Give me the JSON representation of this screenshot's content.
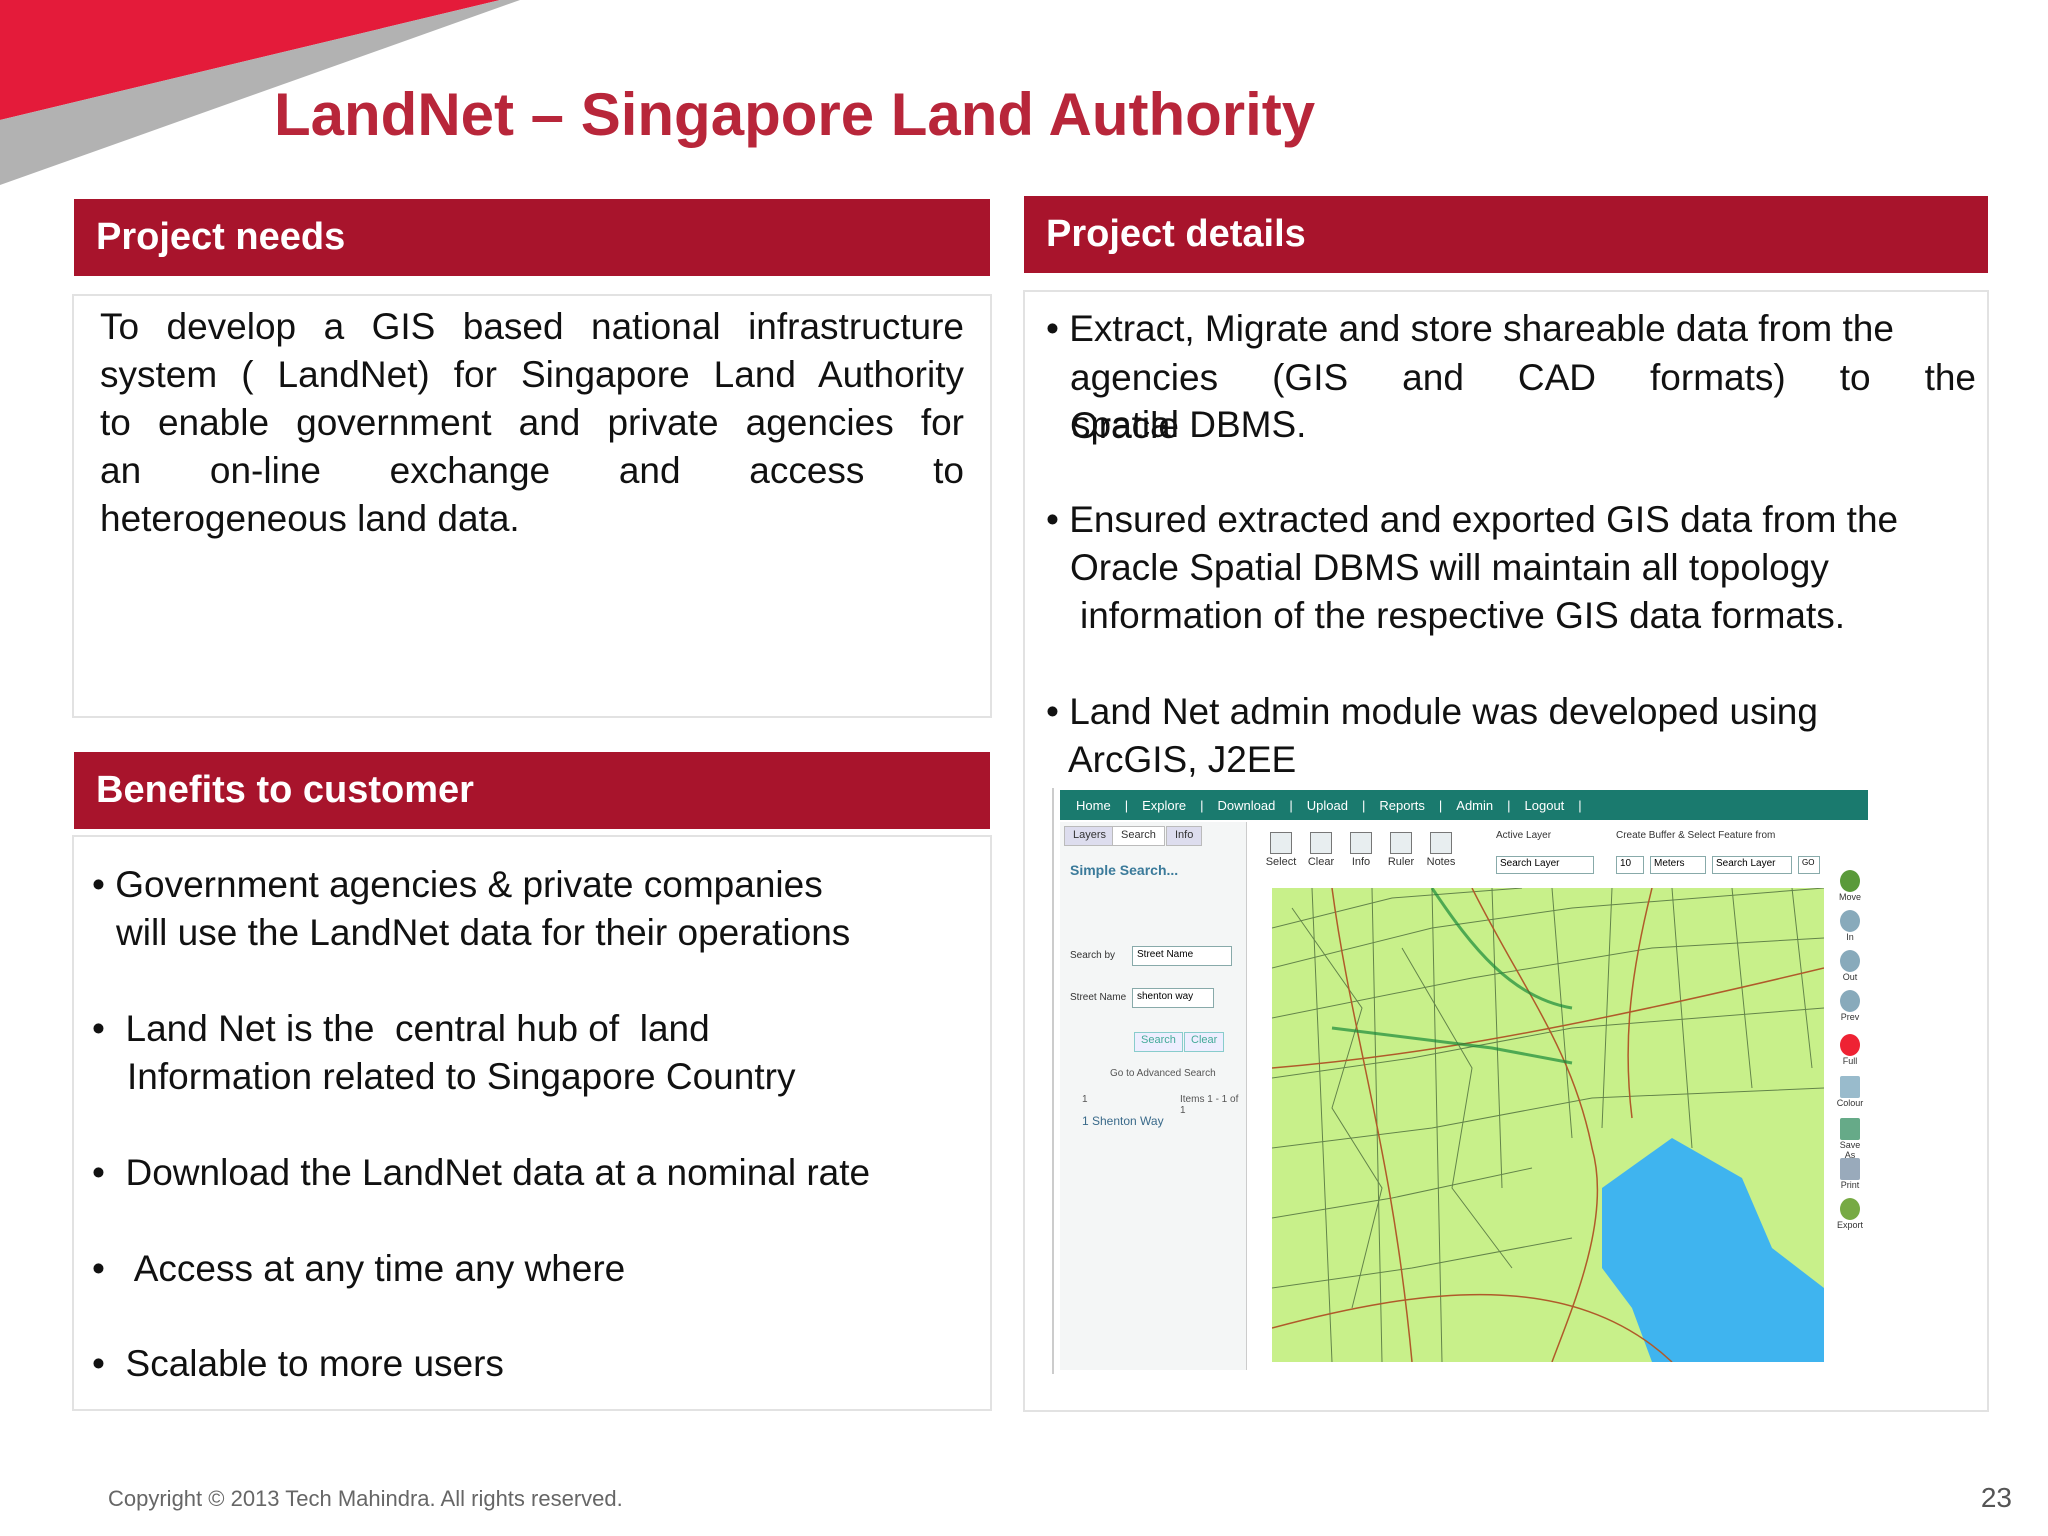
{
  "slide": {
    "title": "LandNet – Singapore Land Authority",
    "footer": "Copyright © 2013 Tech Mahindra. All rights reserved.",
    "page_number": "23",
    "accent_color": "#a8142c",
    "title_color": "#b8263a"
  },
  "project_needs": {
    "heading": "Project needs",
    "lines": [
      "To develop a GIS based national infrastructure",
      "system ( LandNet) for Singapore Land Authority",
      "to enable government and private agencies for",
      "an on-line exchange and access to",
      "heterogeneous land data."
    ]
  },
  "project_details": {
    "heading": "Project details",
    "p1": [
      "• Extract, Migrate and store shareable data from the",
      "agencies (GIS and CAD formats) to the Oracle",
      "spatial DBMS."
    ],
    "p2": [
      "• Ensured extracted and exported GIS data from the",
      "Oracle Spatial DBMS will maintain all topology",
      "information of the respective GIS data formats."
    ],
    "p3": [
      "• Land Net admin module was developed using",
      "ArcGIS, J2EE"
    ]
  },
  "benefits": {
    "heading": "Benefits to customer",
    "items": [
      [
        "• Government agencies & private companies",
        "will use the LandNet data for their operations"
      ],
      [
        "•  Land Net is the  central hub of  land",
        "Information related to Singapore Country"
      ],
      [
        "•  Download the LandNet data at a nominal rate"
      ],
      [
        "•   Access at any time any where"
      ],
      [
        "•  Scalable to more users"
      ]
    ]
  },
  "screenshot": {
    "nav": [
      "Home",
      "|",
      "Explore",
      "|",
      "Download",
      "|",
      "Upload",
      "|",
      "Reports",
      "|",
      "Admin",
      "|",
      "Logout",
      "|"
    ],
    "tabs": [
      "Layers",
      "Search",
      "Info"
    ],
    "panel_title": "Simple Search...",
    "search_by_label": "Search by",
    "search_by_value": "Street Name",
    "street_name_label": "Street Name",
    "street_name_value": "shenton way",
    "search_btn": "Search",
    "clear_btn": "Clear",
    "advanced_link": "Go to Advanced Search",
    "result_index": "1",
    "items_count": "Items 1 - 1 of 1",
    "result": "1 Shenton Way",
    "tools": [
      "Select",
      "Clear",
      "Info",
      "Ruler",
      "Notes"
    ],
    "active_layer_label": "Active Layer",
    "active_layer_value": "Search Layer",
    "buffer_label": "Create Buffer & Select Feature from",
    "buffer_distance": "10",
    "buffer_unit": "Meters",
    "buffer_layer": "Search Layer",
    "go_btn": "GO",
    "right_tools": [
      "Move",
      "In",
      "Out",
      "Prev",
      "Full",
      "Colour",
      "Save As",
      "Print",
      "Export"
    ]
  }
}
